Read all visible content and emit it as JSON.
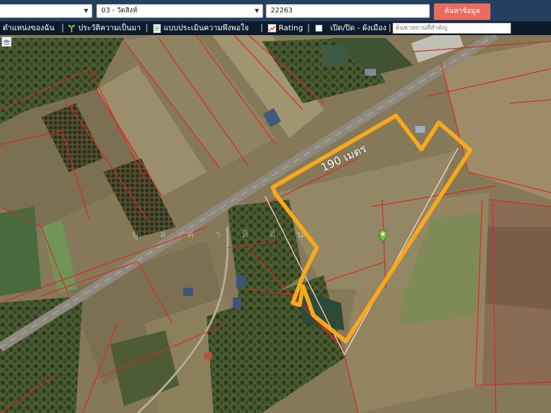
{
  "header": {
    "province_select": {
      "value": ""
    },
    "district_select": {
      "value": "03 - วัดสิงห์"
    },
    "parcel_input": {
      "value": "22263"
    },
    "search_button": {
      "label": "ค้นหาข้อมูล"
    }
  },
  "menu": {
    "items": [
      {
        "label": "ตำแหน่งของฉัน"
      },
      {
        "label": "ประวัติความเป็นมา"
      },
      {
        "label": "แบบประเมินความพึงพอใจ"
      },
      {
        "label": "Rating"
      },
      {
        "label": "เปิด/ปิด - ผังเมือง"
      }
    ],
    "place_search": {
      "placeholder": "ค้นหาสถานที่สำคัญ"
    }
  },
  "map": {
    "distance_label": "190 เมตร",
    "watermark_text": "มูลค่าที่ดิน",
    "colors": {
      "outline": "#f7a81b",
      "parcel_lines": "#e0261f",
      "road": "#8f8a7e"
    },
    "icons": {
      "layers": "layers-icon",
      "pin": "location-pin-icon"
    }
  }
}
